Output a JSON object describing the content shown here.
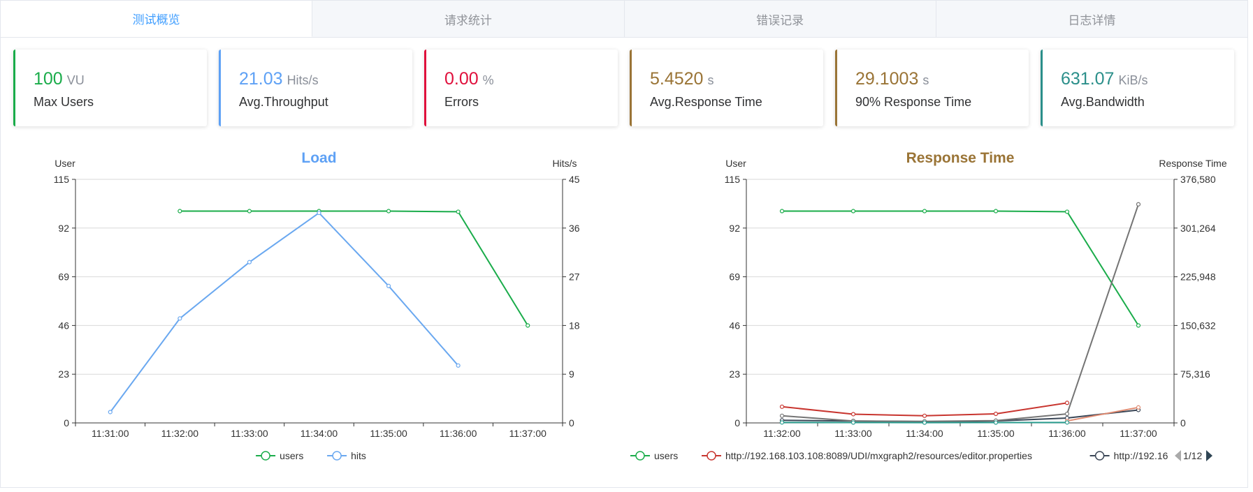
{
  "tabs": [
    {
      "label": "测试概览",
      "active": true
    },
    {
      "label": "请求统计",
      "active": false
    },
    {
      "label": "错误记录",
      "active": false
    },
    {
      "label": "日志详情",
      "active": false
    }
  ],
  "cards": [
    {
      "value": "100",
      "unit": "VU",
      "label": "Max Users",
      "color": "#1aac4a"
    },
    {
      "value": "21.03",
      "unit": "Hits/s",
      "label": "Avg.Throughput",
      "color": "#5ea1f5"
    },
    {
      "value": "0.00",
      "unit": "%",
      "label": "Errors",
      "color": "#e0103c"
    },
    {
      "value": "5.4520",
      "unit": "s",
      "label": "Avg.Response Time",
      "color": "#9a7436"
    },
    {
      "value": "29.1003",
      "unit": "s",
      "label": "90% Response Time",
      "color": "#9a7436"
    },
    {
      "value": "631.07",
      "unit": "KiB/s",
      "label": "Avg.Bandwidth",
      "color": "#2b8f8a"
    }
  ],
  "chart_data": [
    {
      "type": "line",
      "title": "Load",
      "title_color": "#5ea1f5",
      "ylabel": "User",
      "ylabel_right": "Hits/s",
      "categories": [
        "11:31:00",
        "11:32:00",
        "11:33:00",
        "11:34:00",
        "11:35:00",
        "11:36:00",
        "11:37:00"
      ],
      "y_ticks": [
        "0",
        "23",
        "46",
        "69",
        "92",
        "115"
      ],
      "y_right_ticks": [
        "0",
        "9",
        "18",
        "27",
        "36",
        "45"
      ],
      "ylim": [
        0,
        115
      ],
      "ylim_right": [
        0,
        45
      ],
      "grid": true,
      "legend_position": "bottom",
      "series": [
        {
          "name": "users",
          "axis": "left",
          "color": "#1aac4a",
          "values": [
            null,
            100,
            100,
            100,
            100,
            99.7,
            46
          ]
        },
        {
          "name": "hits",
          "axis": "right",
          "color": "#6aa8f0",
          "values": [
            2,
            19.3,
            29.7,
            38.8,
            25.3,
            10.6,
            null
          ]
        }
      ]
    },
    {
      "type": "line",
      "title": "Response Time",
      "title_color": "#9a7436",
      "ylabel": "User",
      "ylabel_right": "Response Time",
      "categories": [
        "11:32:00",
        "11:33:00",
        "11:34:00",
        "11:35:00",
        "11:36:00",
        "11:37:00"
      ],
      "y_ticks": [
        "0",
        "23",
        "46",
        "69",
        "92",
        "115"
      ],
      "y_right_ticks": [
        "0",
        "75,316",
        "150,632",
        "225,948",
        "301,264",
        "376,580"
      ],
      "ylim": [
        0,
        115
      ],
      "ylim_right": [
        0,
        376580
      ],
      "grid": true,
      "legend_position": "bottom",
      "legend_page": "1/12",
      "series": [
        {
          "name": "users",
          "axis": "left",
          "color": "#1aac4a",
          "values": [
            100,
            100,
            100,
            100,
            99.7,
            46
          ]
        },
        {
          "name": "http://192.168.103.108:8089/UDI/mxgraph2/resources/editor.properties",
          "axis": "right",
          "color": "#c8352f",
          "values": [
            25000,
            13500,
            11000,
            14000,
            31000,
            null
          ]
        },
        {
          "name": "http://192.16",
          "axis": "right",
          "color": "#3a4656",
          "values": [
            4000,
            3000,
            2000,
            3000,
            7500,
            20000
          ]
        },
        {
          "name": "",
          "axis": "right",
          "color": "#e08a70",
          "legend": false,
          "values": [
            null,
            null,
            null,
            null,
            3000,
            24000
          ]
        },
        {
          "name": "",
          "axis": "right",
          "color": "#747474",
          "legend": false,
          "values": [
            11000,
            3000,
            2500,
            3500,
            14000,
            338000
          ]
        },
        {
          "name": "",
          "axis": "right",
          "color": "#2a9d8f",
          "legend": false,
          "values": [
            700,
            500,
            400,
            500,
            700,
            null
          ]
        }
      ]
    }
  ]
}
